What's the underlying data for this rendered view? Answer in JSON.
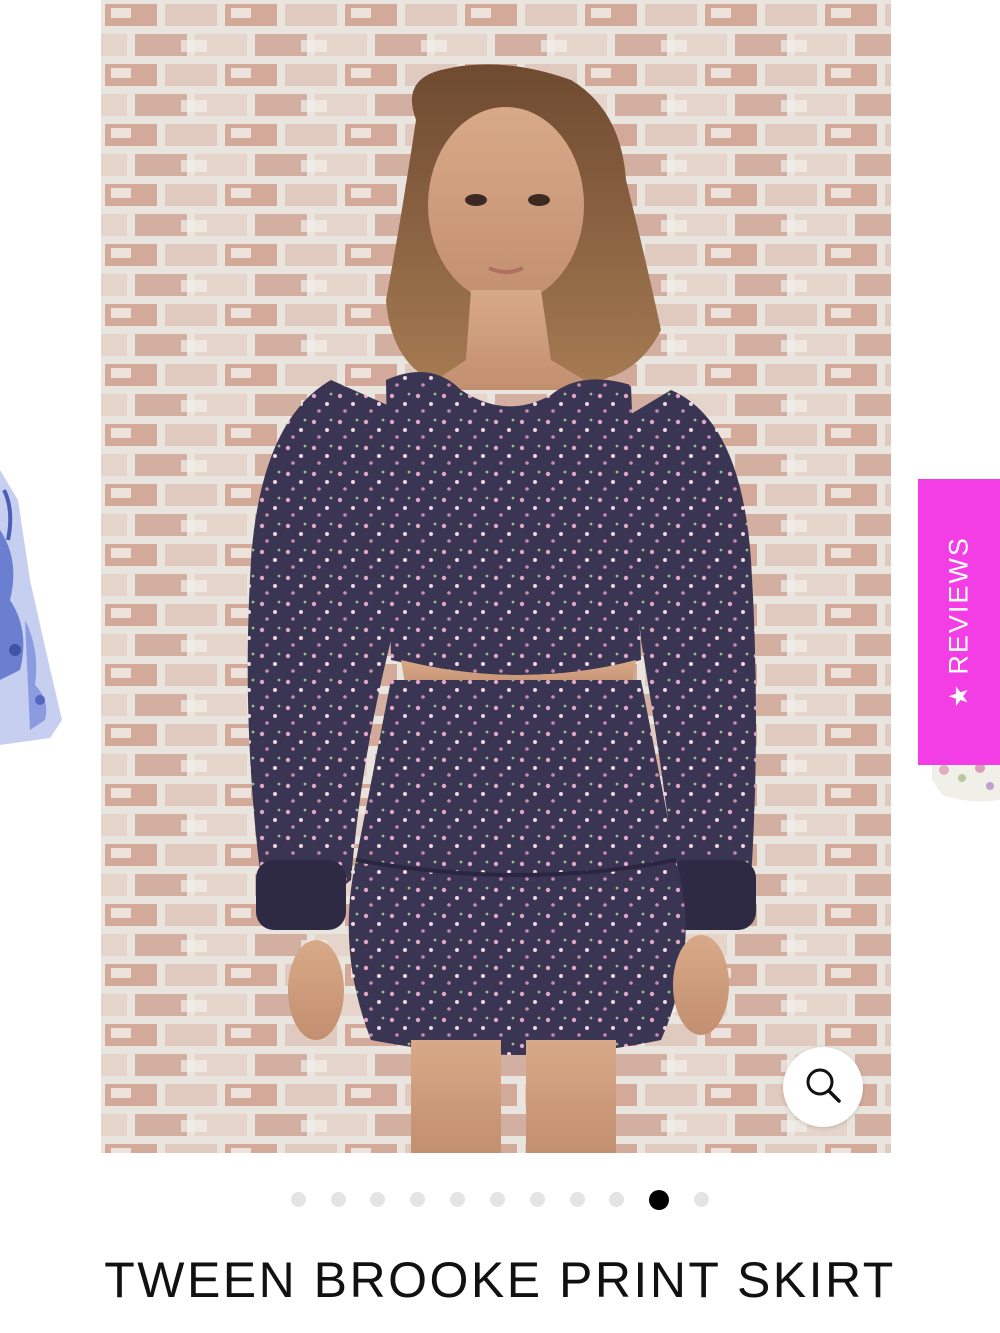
{
  "product": {
    "title": "TWEEN BROOKE PRINT SKIRT"
  },
  "reviews_tab": {
    "label": "REVIEWS",
    "star": "★",
    "background_color": "#f33ee6"
  },
  "zoom": {
    "icon": "search-icon"
  },
  "gallery": {
    "slide_count": 11,
    "active_index": 9,
    "main_image_alt": "Girl wearing navy floral smocked long-sleeve top and tiered skirt in front of a whitewashed brick wall"
  },
  "colors": {
    "accent": "#f33ee6",
    "dot_inactive": "#e4e4e4",
    "dot_active": "#000000",
    "title_text": "#111111"
  }
}
